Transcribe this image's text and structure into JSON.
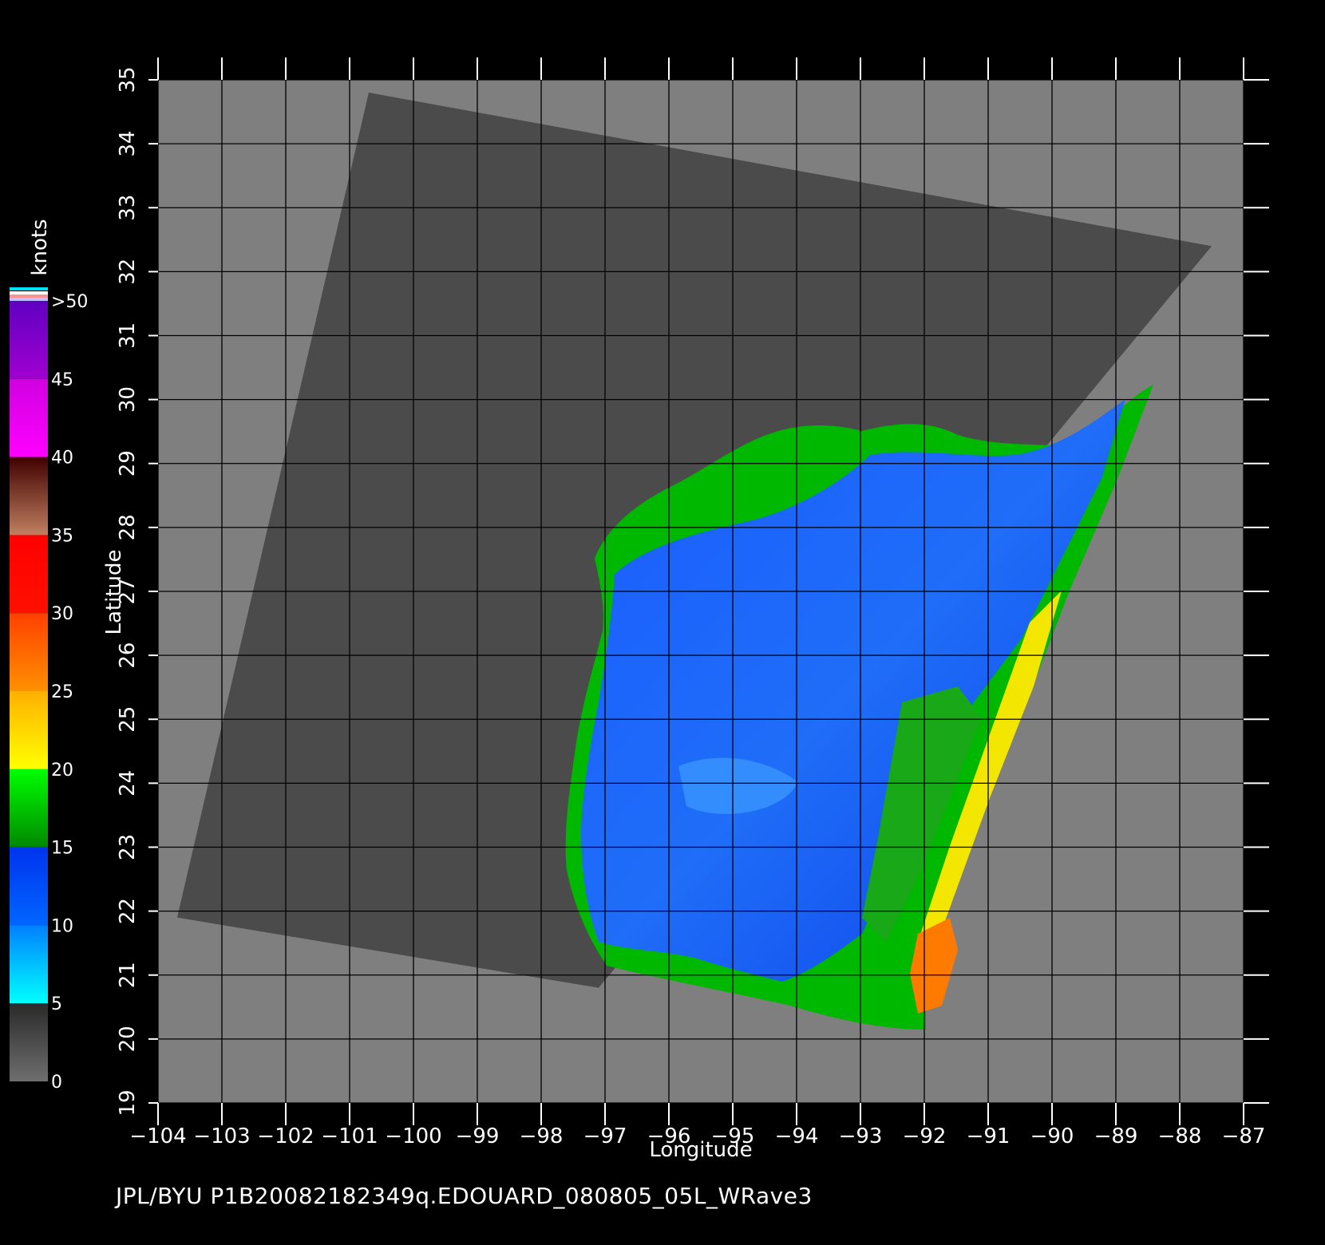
{
  "map": {
    "xlabel": "Longitude",
    "ylabel": "Latitude",
    "lon_range": [
      -104,
      -87
    ],
    "lat_range": [
      19,
      35
    ],
    "lon_ticks": [
      -104,
      -103,
      -102,
      -101,
      -100,
      -99,
      -98,
      -97,
      -96,
      -95,
      -94,
      -93,
      -92,
      -91,
      -90,
      -89,
      -88,
      -87
    ],
    "lat_ticks": [
      19,
      20,
      21,
      22,
      23,
      24,
      25,
      26,
      27,
      28,
      29,
      30,
      31,
      32,
      33,
      34,
      35
    ],
    "grid": true
  },
  "colorbar": {
    "unit": "knots",
    "labels": [
      "0",
      "5",
      "10",
      "15",
      "20",
      "25",
      "30",
      "35",
      "40",
      "45",
      ">50"
    ],
    "bands": [
      {
        "from": 0,
        "to": 5,
        "colors": [
          "#6e6e6e",
          "#2a2a2a"
        ]
      },
      {
        "from": 5,
        "to": 10,
        "colors": [
          "#00ffff",
          "#0080ff"
        ]
      },
      {
        "from": 10,
        "to": 15,
        "colors": [
          "#0066ff",
          "#0033ee"
        ]
      },
      {
        "from": 15,
        "to": 20,
        "colors": [
          "#008800",
          "#00ff00"
        ]
      },
      {
        "from": 20,
        "to": 25,
        "colors": [
          "#ffff00",
          "#ffb000"
        ]
      },
      {
        "from": 25,
        "to": 30,
        "colors": [
          "#ff9000",
          "#ff4000"
        ]
      },
      {
        "from": 30,
        "to": 35,
        "colors": [
          "#ff1000",
          "#ff0000"
        ]
      },
      {
        "from": 35,
        "to": 40,
        "colors": [
          "#c08060",
          "#400000"
        ]
      },
      {
        "from": 40,
        "to": 45,
        "colors": [
          "#ff00ff",
          "#d000e0"
        ]
      },
      {
        "from": 45,
        "to": 50,
        "colors": [
          "#a000d0",
          "#6000c0"
        ]
      }
    ]
  },
  "colors": {
    "background": "#000000",
    "land": "#7f7f7f",
    "swath": "#4b4b4b",
    "grid": "#000000",
    "axis": "#ffffff"
  },
  "swath_corners_lonlat": [
    [
      -100.7,
      34.8
    ],
    [
      -87.5,
      32.4
    ],
    [
      -97.1,
      20.8
    ],
    [
      -103.7,
      21.9
    ]
  ],
  "footer": {
    "text": "JPL/BYU  P1B20082182349q.EDOUARD_080805_05L_WRave3"
  }
}
